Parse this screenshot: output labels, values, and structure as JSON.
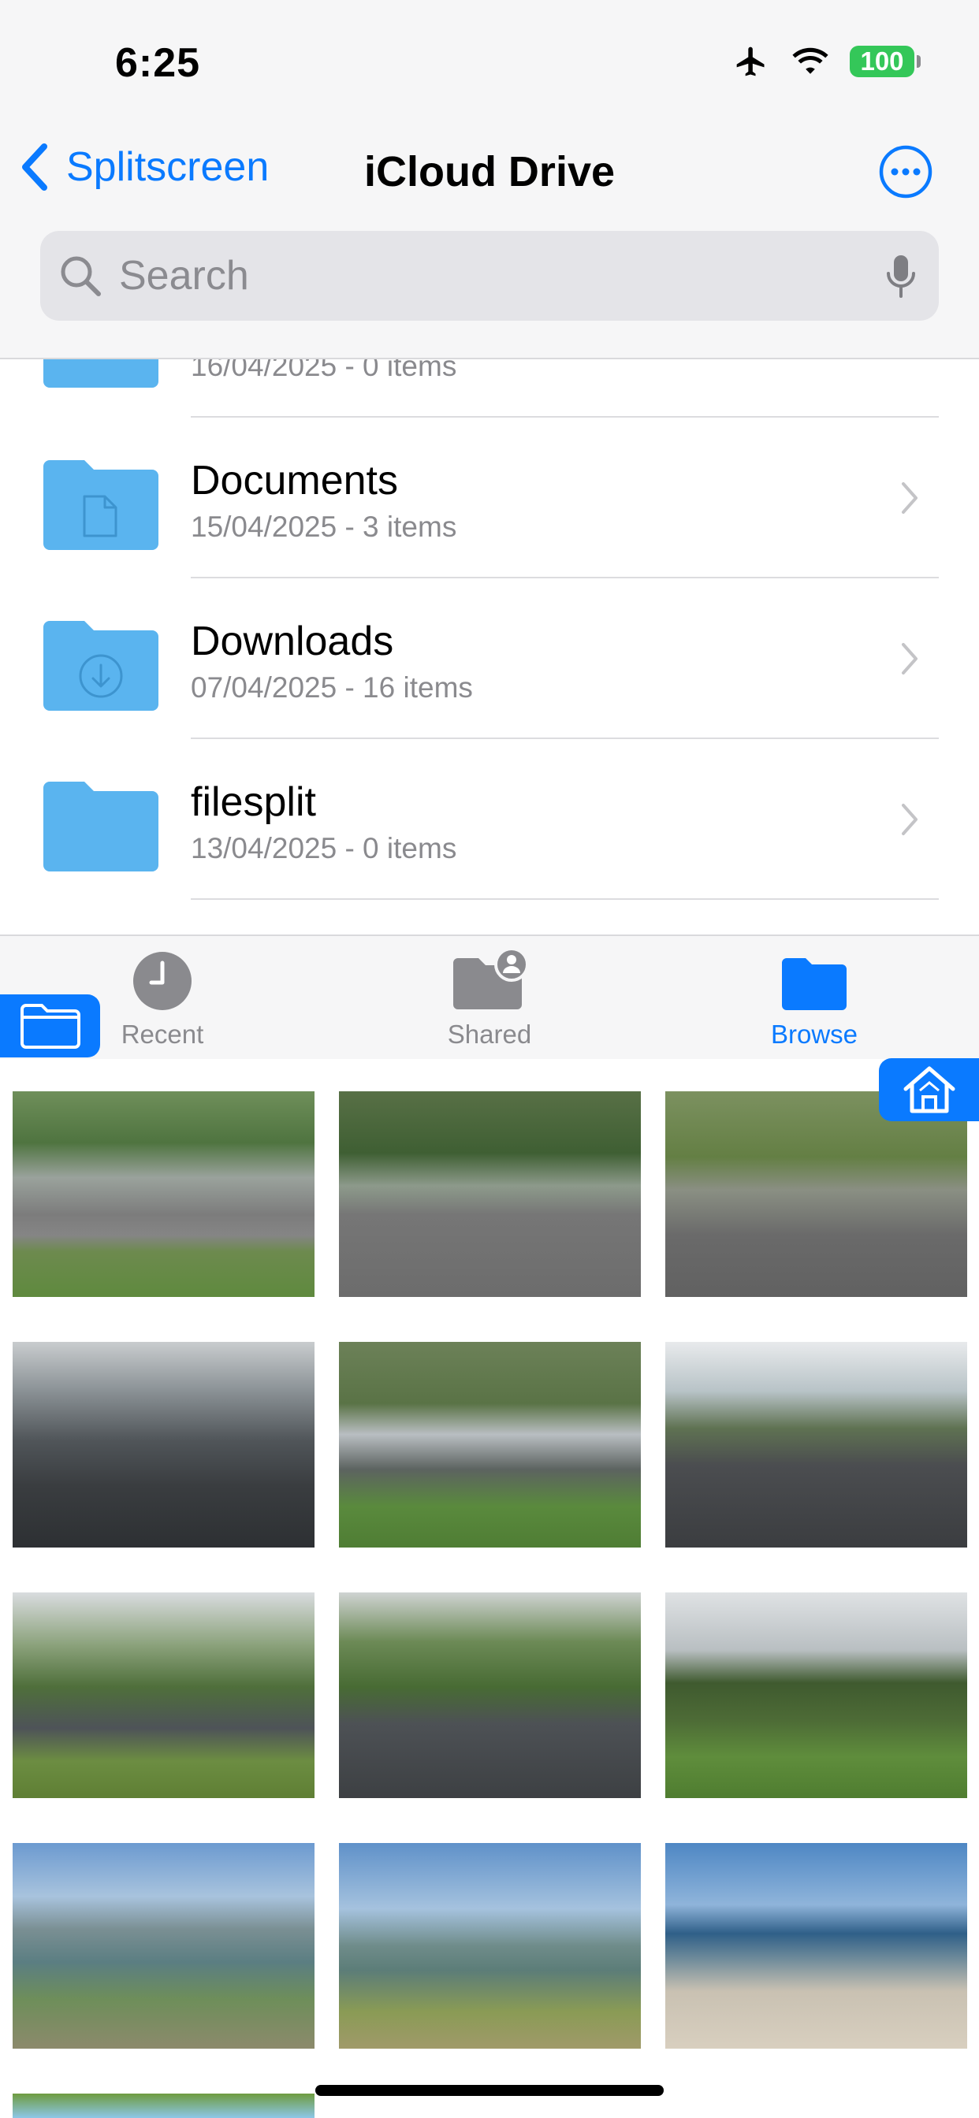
{
  "status_bar": {
    "time": "6:25",
    "battery": "100",
    "icons": [
      "airplane-icon",
      "wifi-icon",
      "battery-icon"
    ]
  },
  "nav": {
    "back_label": "Splitscreen",
    "title": "iCloud Drive",
    "more_icon": "ellipsis-circle-icon"
  },
  "search": {
    "placeholder": "Search",
    "value": ""
  },
  "files": [
    {
      "name": "",
      "meta": "16/04/2025 - 0 items",
      "icon": "folder-icon"
    },
    {
      "name": "Documents",
      "meta": "15/04/2025 - 3 items",
      "icon": "documents-folder-icon"
    },
    {
      "name": "Downloads",
      "meta": "07/04/2025 - 16 items",
      "icon": "downloads-folder-icon"
    },
    {
      "name": "filesplit",
      "meta": "13/04/2025 - 0 items",
      "icon": "folder-icon"
    }
  ],
  "tabs": [
    {
      "label": "Recent",
      "icon": "clock-icon",
      "active": false
    },
    {
      "label": "Shared",
      "icon": "shared-folder-icon",
      "active": false
    },
    {
      "label": "Browse",
      "icon": "folder-icon",
      "active": true
    }
  ],
  "photos": [
    "footpath-park",
    "road-crossing",
    "road-crossing-lines",
    "wet-street-shops",
    "path-trees",
    "wet-road-curve",
    "wet-road-trees",
    "road-runner",
    "park-dusk",
    "harbour-path",
    "harbour-flax",
    "beach-people",
    "trees-sky"
  ],
  "colors": {
    "accent": "#0a7aff",
    "folder": "#5ab4ef",
    "battery": "#34c759"
  }
}
